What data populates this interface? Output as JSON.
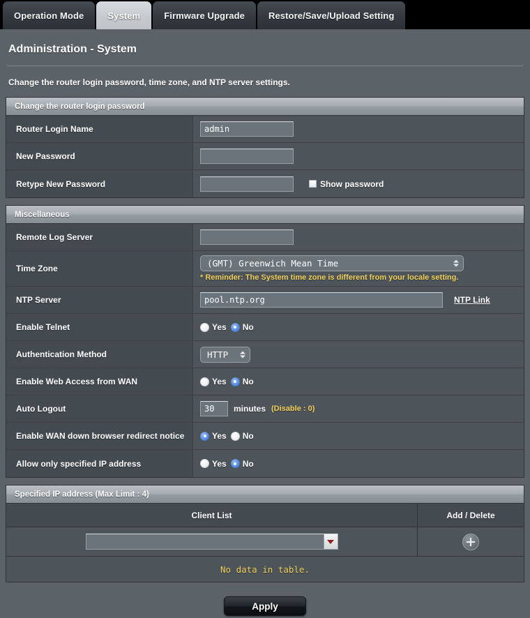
{
  "tabs": [
    {
      "label": "Operation Mode",
      "active": false
    },
    {
      "label": "System",
      "active": true
    },
    {
      "label": "Firmware Upgrade",
      "active": false
    },
    {
      "label": "Restore/Save/Upload Setting",
      "active": false
    }
  ],
  "header": {
    "title": "Administration - System",
    "description": "Change the router login password, time zone, and NTP server settings."
  },
  "sections": {
    "password": {
      "title": "Change the router login password",
      "rows": {
        "router_login_name": {
          "label": "Router Login Name",
          "value": "admin"
        },
        "new_password": {
          "label": "New Password",
          "value": ""
        },
        "retype_new_password": {
          "label": "Retype New Password",
          "value": ""
        }
      },
      "show_password_label": "Show password"
    },
    "misc": {
      "title": "Miscellaneous",
      "rows": {
        "remote_log_server": {
          "label": "Remote Log Server",
          "value": ""
        },
        "time_zone": {
          "label": "Time Zone",
          "value": "(GMT) Greenwich Mean Time",
          "reminder": "* Reminder: The System time zone is different from your locale setting."
        },
        "ntp_server": {
          "label": "NTP Server",
          "value": "pool.ntp.org",
          "link_label": "NTP Link"
        },
        "enable_telnet": {
          "label": "Enable Telnet",
          "yes_label": "Yes",
          "no_label": "No",
          "selected": "No"
        },
        "authentication_method": {
          "label": "Authentication Method",
          "value": "HTTP"
        },
        "enable_web_access_wan": {
          "label": "Enable Web Access from WAN",
          "yes_label": "Yes",
          "no_label": "No",
          "selected": "No"
        },
        "auto_logout": {
          "label": "Auto Logout",
          "value": "30",
          "unit": "minutes",
          "hint": "(Disable : 0)"
        },
        "wan_down_redirect": {
          "label": "Enable WAN down browser redirect notice",
          "yes_label": "Yes",
          "no_label": "No",
          "selected": "Yes"
        },
        "allow_specified_ip": {
          "label": "Allow only specified IP address",
          "yes_label": "Yes",
          "no_label": "No",
          "selected": "No"
        }
      }
    },
    "specified_ip": {
      "title": "Specified IP address (Max Limit : 4)",
      "columns": {
        "client_list": "Client List",
        "add_delete": "Add / Delete"
      },
      "client_input_value": "",
      "empty_message": "No data in table."
    }
  },
  "footer": {
    "apply_label": "Apply"
  },
  "colors": {
    "panel": "#5b6369",
    "label_column": "#434a50",
    "value_column": "#4d545a",
    "accent_yellow": "#f0cf5a",
    "radio_on": "#5b90e8",
    "dropdown_arrow_red": "#8e1f1f"
  }
}
